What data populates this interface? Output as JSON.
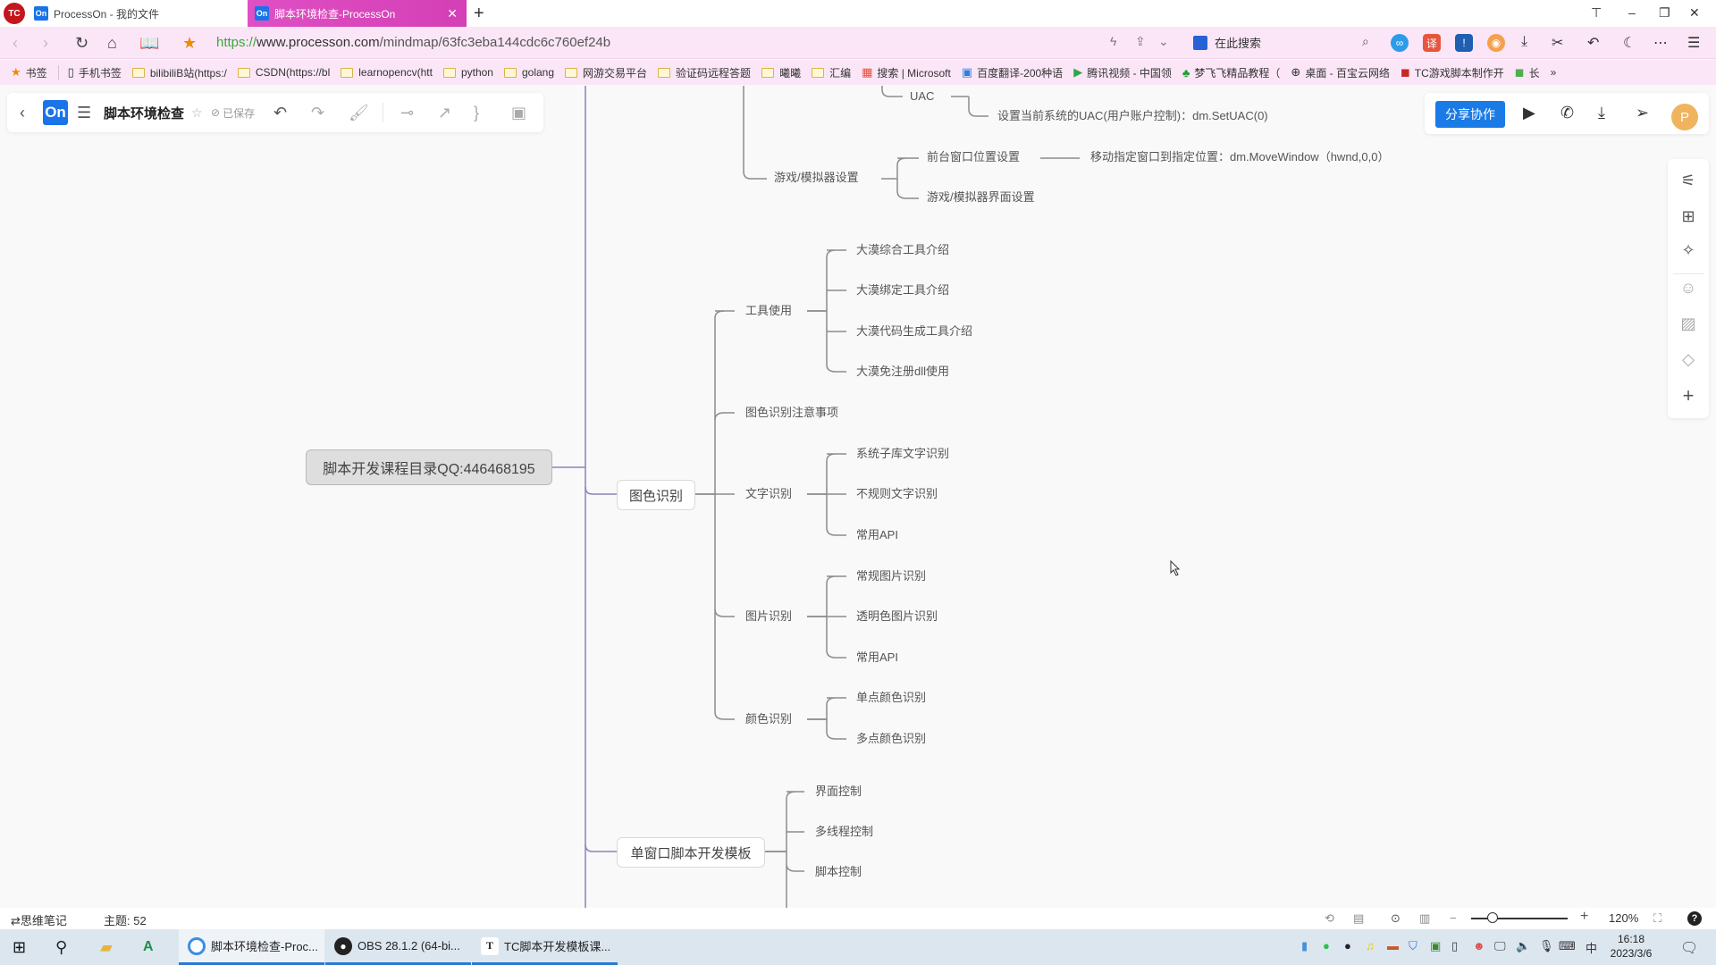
{
  "browser": {
    "tabs": [
      {
        "label": "ProcessOn - 我的文件",
        "favicon": "On",
        "active": false
      },
      {
        "label": "脚本环境检查-ProcessOn",
        "favicon": "On",
        "active": true
      }
    ],
    "new_tab_icon": "+",
    "url": {
      "scheme": "https://",
      "host": "www.processon.com",
      "path": "/mindmap/63fc3eba144cdc6c760ef24b"
    },
    "search_placeholder": "在此搜索",
    "bookmarks": [
      {
        "label": "书签",
        "icon": "star"
      },
      {
        "label": "手机书签",
        "icon": "phone"
      },
      {
        "label": "bilibiliB站(https:/",
        "icon": "folder"
      },
      {
        "label": "CSDN(https://bl",
        "icon": "folder"
      },
      {
        "label": "learnopencv(htt",
        "icon": "folder"
      },
      {
        "label": "python",
        "icon": "folder"
      },
      {
        "label": "golang",
        "icon": "folder"
      },
      {
        "label": "网游交易平台",
        "icon": "folder"
      },
      {
        "label": "验证码远程答题",
        "icon": "folder"
      },
      {
        "label": "曦曦",
        "icon": "folder"
      },
      {
        "label": "汇编",
        "icon": "folder"
      },
      {
        "label": "搜索 | Microsoft",
        "icon": "windows"
      },
      {
        "label": "百度翻译-200种语",
        "icon": "translate"
      },
      {
        "label": "腾讯视频 - 中国领",
        "icon": "video"
      },
      {
        "label": "梦飞飞精品教程（",
        "icon": "tree"
      },
      {
        "label": "桌面 - 百宝云网络",
        "icon": "globe"
      },
      {
        "label": "TC游戏脚本制作开",
        "icon": "app"
      },
      {
        "label": "长",
        "icon": "app-green"
      }
    ],
    "bookmarks_more": "»"
  },
  "app": {
    "logo": "On",
    "doc_title": "脚本环境检查",
    "saved_status": "已保存",
    "share_label": "分享协作",
    "avatar_letter": "P"
  },
  "mindmap": {
    "root": "脚本开发课程目录QQ:446468195",
    "nodes": {
      "uac": "UAC",
      "uac_set": "设置当前系统的UAC(用户账户控制)：dm.SetUAC(0)",
      "game_settings": "游戏/模拟器设置",
      "front_window": "前台窗口位置设置",
      "move_window": "移动指定窗口到指定位置：dm.MoveWindow（hwnd,0,0）",
      "game_ui": "游戏/模拟器界面设置",
      "image_color": "图色识别",
      "tools": "工具使用",
      "tool_1": "大漠综合工具介绍",
      "tool_2": "大漠绑定工具介绍",
      "tool_3": "大漠代码生成工具介绍",
      "tool_4": "大漠免注册dll使用",
      "notes": "图色识别注意事项",
      "text_rec": "文字识别",
      "text_1": "系统子库文字识别",
      "text_2": "不规则文字识别",
      "text_3": "常用API",
      "pic_rec": "图片识别",
      "pic_1": "常规图片识别",
      "pic_2": "透明色图片识别",
      "pic_3": "常用API",
      "color_rec": "颜色识别",
      "color_1": "单点颜色识别",
      "color_2": "多点颜色识别",
      "template": "单窗口脚本开发模板",
      "tpl_1": "界面控制",
      "tpl_2": "多线程控制",
      "tpl_3": "脚本控制"
    }
  },
  "footer": {
    "mode_label": "⇄思维笔记",
    "topic_count_label": "主题:",
    "topic_count": "52",
    "zoom_level": "120%",
    "zoom_fraction": 0.22,
    "help": "?"
  },
  "taskbar": {
    "apps": [
      {
        "label": "脚本环境检查-Proc...",
        "active": true
      },
      {
        "label": "OBS 28.1.2 (64-bi...",
        "active": false
      },
      {
        "label": "TC脚本开发模板课...",
        "active": false
      }
    ],
    "ime": "中",
    "time": "16:18",
    "date": "2023/3/6"
  },
  "colors": {
    "accent": "#1a7be6",
    "tab_active": "#d844bb",
    "address_bg": "#fbe6f7",
    "main_branch": "#8a83b8",
    "sub_branch": "#8c8c8c",
    "avatar": "#f0b45e"
  }
}
